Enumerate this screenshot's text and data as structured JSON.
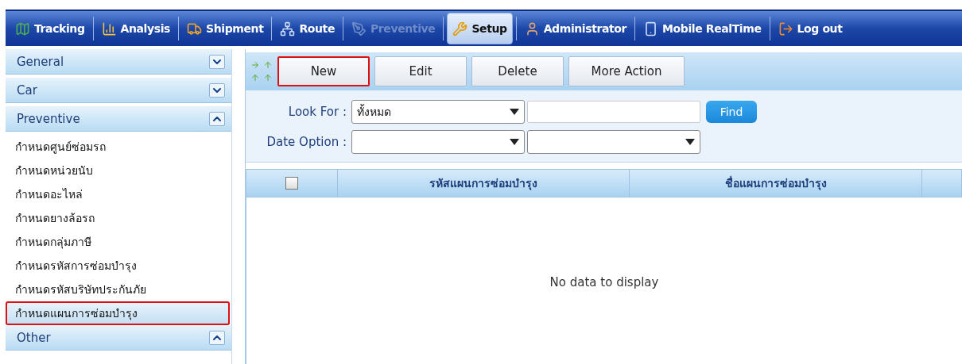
{
  "navbar": {
    "items": [
      {
        "label": "Tracking",
        "selected": false,
        "disabled": false
      },
      {
        "label": "Analysis",
        "selected": false,
        "disabled": false
      },
      {
        "label": "Shipment",
        "selected": false,
        "disabled": false
      },
      {
        "label": "Route",
        "selected": false,
        "disabled": false
      },
      {
        "label": "Preventive",
        "selected": false,
        "disabled": true
      },
      {
        "label": "Setup",
        "selected": true,
        "disabled": false
      },
      {
        "label": "Administrator",
        "selected": false,
        "disabled": false
      },
      {
        "label": "Mobile RealTime",
        "selected": false,
        "disabled": false
      },
      {
        "label": "Log out",
        "selected": false,
        "disabled": false
      }
    ]
  },
  "sidebar": {
    "groups": [
      {
        "label": "General",
        "expanded": false
      },
      {
        "label": "Car",
        "expanded": false
      },
      {
        "label": "Preventive",
        "expanded": true,
        "items": [
          {
            "label": "กำหนดศูนย์ซ่อมรถ",
            "selected": false,
            "highlighted": false
          },
          {
            "label": "กำหนดหน่วยนับ",
            "selected": false,
            "highlighted": false
          },
          {
            "label": "กำหนดอะไหล่",
            "selected": false,
            "highlighted": false
          },
          {
            "label": "กำหนดยางล้อรถ",
            "selected": false,
            "highlighted": false
          },
          {
            "label": "กำหนดกลุ่มภาษี",
            "selected": false,
            "highlighted": false
          },
          {
            "label": "กำหนดรหัสการซ่อมบำรุง",
            "selected": false,
            "highlighted": false
          },
          {
            "label": "กำหนดรหัสบริษัทประกันภัย",
            "selected": false,
            "highlighted": false
          },
          {
            "label": "กำหนดแผนการซ่อมบำรุง",
            "selected": true,
            "highlighted": true
          }
        ]
      },
      {
        "label": "Other",
        "expanded": true
      }
    ]
  },
  "toolbar": {
    "buttons": [
      {
        "label": "New",
        "highlighted": true
      },
      {
        "label": "Edit",
        "highlighted": false
      },
      {
        "label": "Delete",
        "highlighted": false
      },
      {
        "label": "More Action",
        "highlighted": false
      }
    ]
  },
  "filters": {
    "look_for": {
      "label": "Look For :",
      "value": "ทั้งหมด"
    },
    "date_option": {
      "label": "Date Option :"
    },
    "find_button": "Find"
  },
  "table": {
    "select_all_checked": false,
    "columns": [
      "รหัสแผนการซ่อมบำรุง",
      "ชื่อแผนการซ่อมบำรุง"
    ],
    "empty_message": "No data to display"
  }
}
